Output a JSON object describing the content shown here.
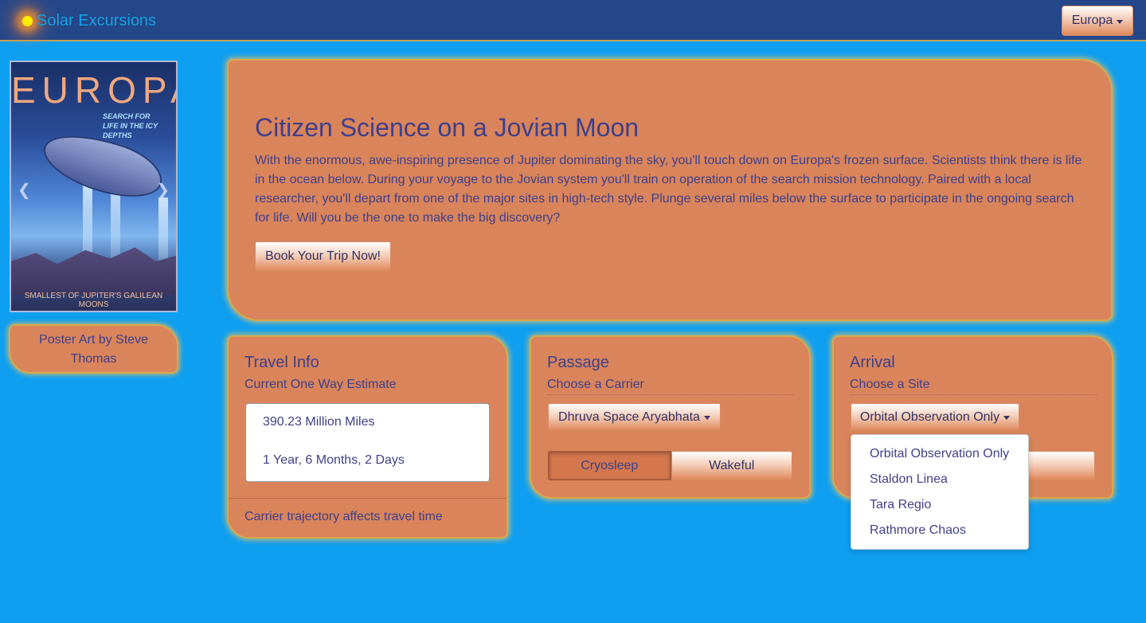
{
  "navbar": {
    "brand": "Solar Excursions",
    "destination_button": "Europa"
  },
  "poster": {
    "title": "EUROPA",
    "tagline": "SEARCH FOR LIFE IN THE ICY DEPTHS",
    "footer": "SMALLEST OF JUPITER'S GALILEAN MOONS",
    "prev_icon": "chevron-left-icon",
    "next_icon": "chevron-right-icon"
  },
  "credit": {
    "text": "Poster Art by  Steve Thomas"
  },
  "hero": {
    "title": "Citizen Science on a Jovian Moon",
    "description": "With the enormous, awe-inspiring presence of Jupiter dominating the sky, you'll touch down on Europa's frozen surface. Scientists think there is life in the ocean below. During your voyage to the Jovian system you'll train on operation of the search mission technology. Paired with a local researcher, you'll depart from one of the major sites in high-tech style. Plunge several miles below the surface to participate in the ongoing search for life. Will you be the one to make the big discovery?",
    "book_button": "Book Your Trip Now!"
  },
  "travel": {
    "title": "Travel Info",
    "subtitle": "Current One Way Estimate",
    "distance": "390.23 Million Miles",
    "duration": "1 Year, 6 Months, 2 Days",
    "footer": "Carrier trajectory affects travel time"
  },
  "passage": {
    "title": "Passage",
    "subtitle": "Choose a Carrier",
    "carrier": "Dhruva Space Aryabhata",
    "options": [
      "Cryosleep",
      "Wakeful"
    ],
    "selected": "Cryosleep"
  },
  "arrival": {
    "title": "Arrival",
    "subtitle": "Choose a Site",
    "site": "Orbital Observation Only",
    "dropdown_items": [
      "Orbital Observation Only",
      "Staldon Linea",
      "Tara Regio",
      "Rathmore Chaos"
    ]
  },
  "colors": {
    "background": "#0e9ff0",
    "navbar": "#24478a",
    "card": "#d9845b",
    "card_glow": "#d9a84c",
    "text": "#40408a",
    "brand": "#18a3e8"
  }
}
